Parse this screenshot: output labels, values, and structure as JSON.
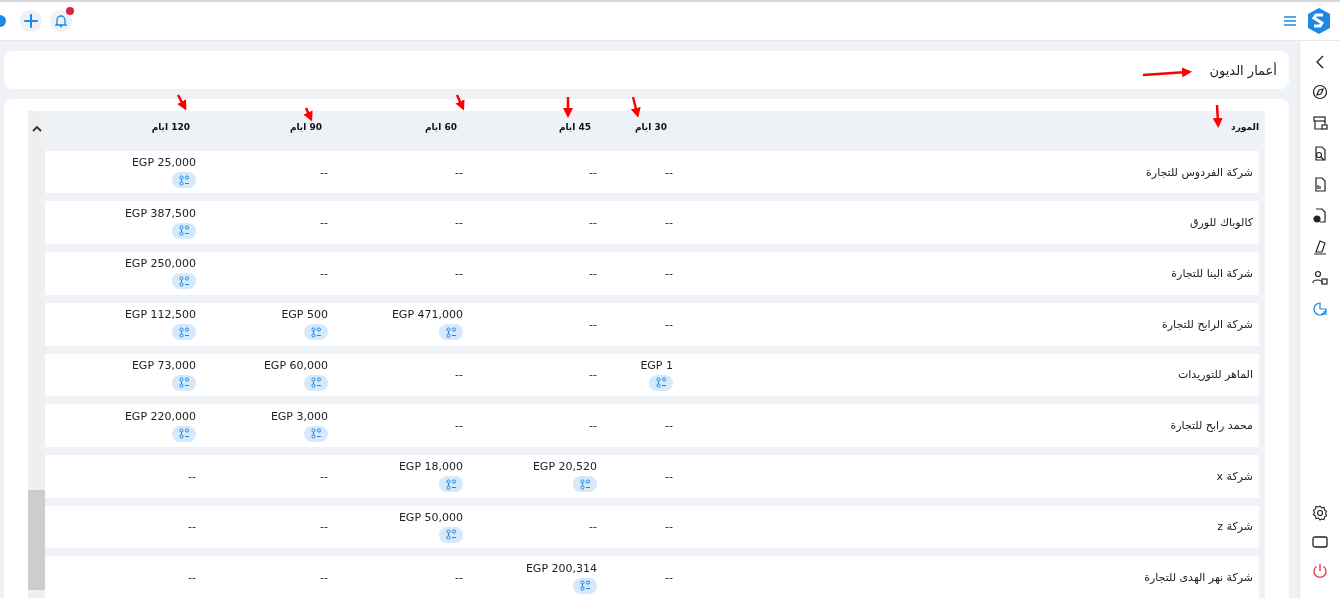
{
  "page_title": "أعمار الديون",
  "sidebar": {
    "items": [
      {
        "selected": false
      },
      {
        "selected": false
      },
      {
        "selected": false
      },
      {
        "selected": false
      },
      {
        "selected": false
      },
      {
        "selected": false
      },
      {
        "selected": false
      },
      {
        "selected": true
      }
    ]
  },
  "table": {
    "columns": [
      "المورد",
      "30 ايام",
      "45 ايام",
      "60 ايام",
      "90 ايام",
      "120 ايام"
    ],
    "rows": [
      {
        "supplier": "شركة الفردوس للتجارة",
        "cells": [
          {
            "kind": "empty",
            "text": "--"
          },
          {
            "kind": "empty",
            "text": "--"
          },
          {
            "kind": "empty",
            "text": "--"
          },
          {
            "kind": "empty",
            "text": "--"
          },
          {
            "kind": "amount",
            "text": "EGP 25,000"
          }
        ]
      },
      {
        "supplier": "كالوباك للورق",
        "cells": [
          {
            "kind": "empty",
            "text": "--"
          },
          {
            "kind": "empty",
            "text": "--"
          },
          {
            "kind": "empty",
            "text": "--"
          },
          {
            "kind": "empty",
            "text": "--"
          },
          {
            "kind": "amount",
            "text": "EGP 387,500"
          }
        ]
      },
      {
        "supplier": "شركة الينا للتجارة",
        "cells": [
          {
            "kind": "empty",
            "text": "--"
          },
          {
            "kind": "empty",
            "text": "--"
          },
          {
            "kind": "empty",
            "text": "--"
          },
          {
            "kind": "empty",
            "text": "--"
          },
          {
            "kind": "amount",
            "text": "EGP 250,000"
          }
        ]
      },
      {
        "supplier": "شركة الرابح للتجارة",
        "cells": [
          {
            "kind": "empty",
            "text": "--"
          },
          {
            "kind": "empty",
            "text": "--"
          },
          {
            "kind": "amount",
            "text": "EGP 471,000"
          },
          {
            "kind": "amount",
            "text": "EGP 500"
          },
          {
            "kind": "amount",
            "text": "EGP 112,500"
          }
        ]
      },
      {
        "supplier": "الماهر للتوريدات",
        "cells": [
          {
            "kind": "amount",
            "text": "EGP 1"
          },
          {
            "kind": "empty",
            "text": "--"
          },
          {
            "kind": "empty",
            "text": "--"
          },
          {
            "kind": "amount",
            "text": "EGP 60,000"
          },
          {
            "kind": "amount",
            "text": "EGP 73,000"
          }
        ]
      },
      {
        "supplier": "محمد رابح للتجارة",
        "cells": [
          {
            "kind": "empty",
            "text": "--"
          },
          {
            "kind": "empty",
            "text": "--"
          },
          {
            "kind": "empty",
            "text": "--"
          },
          {
            "kind": "amount",
            "text": "EGP 3,000"
          },
          {
            "kind": "amount",
            "text": "EGP 220,000"
          }
        ]
      },
      {
        "supplier": "شركة x",
        "cells": [
          {
            "kind": "empty",
            "text": "--"
          },
          {
            "kind": "amount",
            "text": "EGP 20,520"
          },
          {
            "kind": "amount",
            "text": "EGP 18,000"
          },
          {
            "kind": "empty",
            "text": "--"
          },
          {
            "kind": "empty",
            "text": "--"
          }
        ]
      },
      {
        "supplier": "شركة z",
        "cells": [
          {
            "kind": "empty",
            "text": "--"
          },
          {
            "kind": "empty",
            "text": "--"
          },
          {
            "kind": "amount",
            "text": "EGP 50,000"
          },
          {
            "kind": "empty",
            "text": "--"
          },
          {
            "kind": "empty",
            "text": "--"
          }
        ]
      },
      {
        "supplier": "شركة  نهر الهدى للتجارة",
        "cells": [
          {
            "kind": "empty",
            "text": "--"
          },
          {
            "kind": "amount",
            "text": "EGP 200,314"
          },
          {
            "kind": "empty",
            "text": "--"
          },
          {
            "kind": "empty",
            "text": "--"
          },
          {
            "kind": "empty",
            "text": "--"
          }
        ]
      }
    ]
  }
}
